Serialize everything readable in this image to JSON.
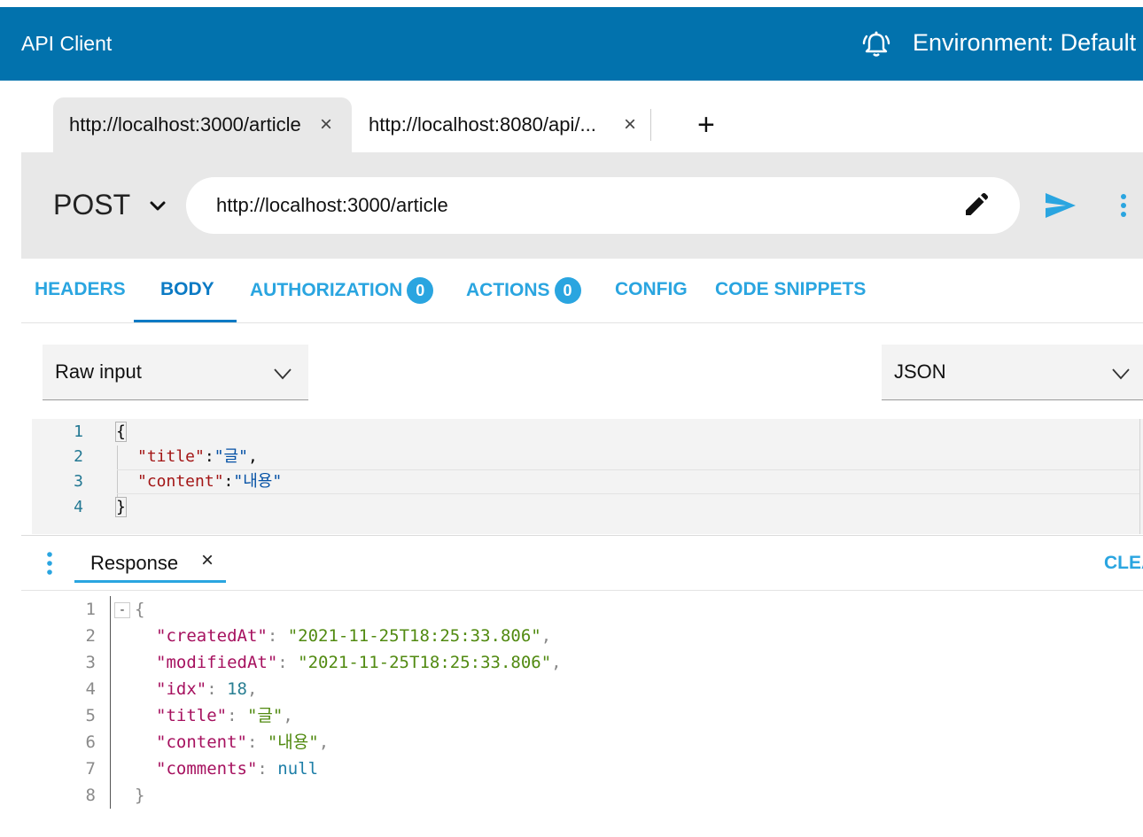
{
  "topbar": {
    "title": "API Client",
    "icon": "bell-icon",
    "environment": "Environment: Default"
  },
  "tabs": [
    {
      "label": "http://localhost:3000/article",
      "close": "×"
    },
    {
      "label": "http://localhost:8080/api/...",
      "close": "×"
    }
  ],
  "add_tab": "+",
  "request": {
    "method": "POST",
    "url": "http://localhost:3000/article"
  },
  "sections": {
    "headers": "HEADERS",
    "body": "BODY",
    "authorization": "AUTHORIZATION",
    "authorization_count": "0",
    "actions": "ACTIONS",
    "actions_count": "0",
    "config": "CONFIG",
    "code_snippets": "CODE SNIPPETS"
  },
  "body": {
    "input_type": "Raw input",
    "content_type": "JSON",
    "line_numbers": [
      "1",
      "2",
      "3",
      "4"
    ],
    "lines": {
      "open": "{",
      "title_key": "\"title\"",
      "title_colon": ":",
      "title_value": "\"글\"",
      "title_comma": ",",
      "content_key": "\"content\"",
      "content_colon": ":",
      "content_value": "\"내용\"",
      "close": "}"
    }
  },
  "response": {
    "tab_label": "Response",
    "tab_close": "×",
    "clear_label": "CLEAR",
    "line_numbers": [
      "1",
      "2",
      "3",
      "4",
      "5",
      "6",
      "7",
      "8"
    ],
    "fold_marker": "-",
    "open": "{",
    "close": "}",
    "fields": {
      "createdAt_key": "\"createdAt\"",
      "createdAt_value": "\"2021-11-25T18:25:33.806\"",
      "modifiedAt_key": "\"modifiedAt\"",
      "modifiedAt_value": "\"2021-11-25T18:25:33.806\"",
      "idx_key": "\"idx\"",
      "idx_value": "18",
      "title_key": "\"title\"",
      "title_value": "\"글\"",
      "content_key": "\"content\"",
      "content_value": "\"내용\"",
      "comments_key": "\"comments\"",
      "comments_value": "null"
    },
    "colon": ": ",
    "comma": ","
  },
  "colors": {
    "topbar": "#0272ad",
    "accent": "#2aa5e0",
    "active_tab": "#0b7ac4"
  }
}
